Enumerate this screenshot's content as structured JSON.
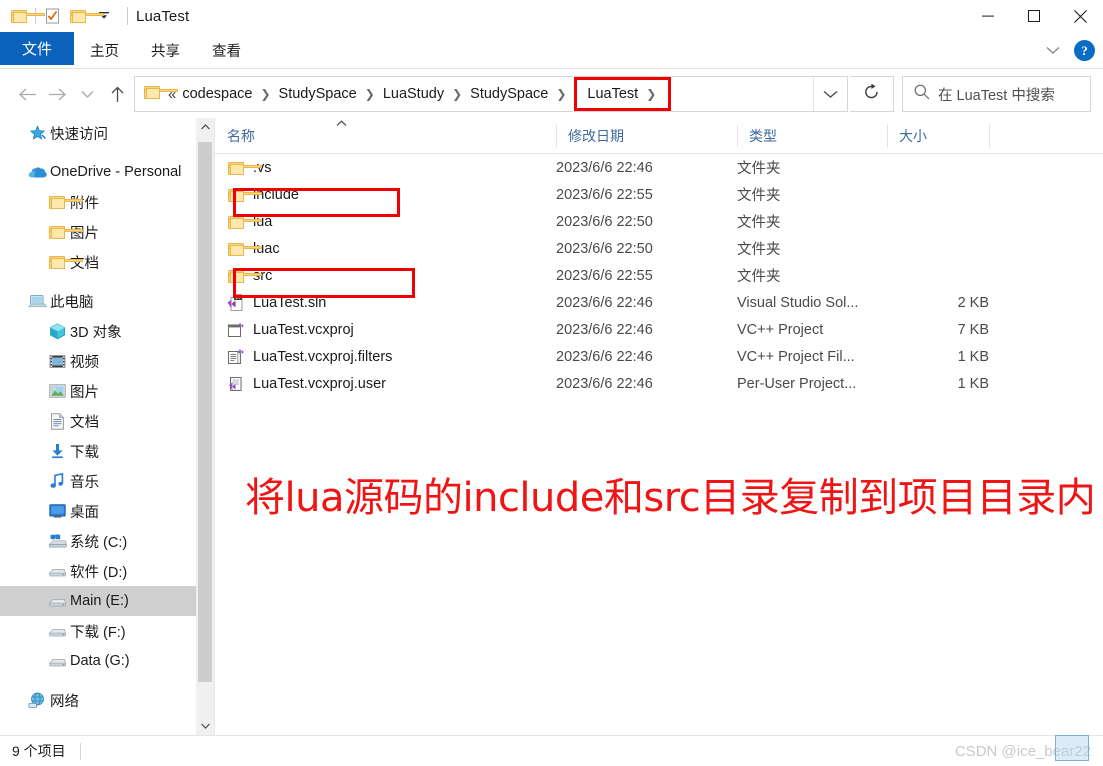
{
  "window": {
    "title": "LuaTest",
    "quick_access_icons": [
      "folder-icon",
      "properties-icon",
      "new-folder-icon",
      "customize-dropdown-icon"
    ],
    "minimize_label": "最小化",
    "maximize_label": "最大化",
    "close_label": "关闭"
  },
  "ribbon": {
    "tabs": [
      {
        "label": "文件",
        "active": true
      },
      {
        "label": "主页",
        "active": false
      },
      {
        "label": "共享",
        "active": false
      },
      {
        "label": "查看",
        "active": false
      }
    ],
    "collapse_icon": "chevron-down-icon",
    "help_label": "?"
  },
  "navbar": {
    "back_label": "←",
    "forward_label": "→",
    "recent_label": "⌄",
    "up_label": "↑",
    "breadcrumb_prefix": "«",
    "breadcrumbs": [
      "codespace",
      "StudySpace",
      "LuaStudy",
      "StudySpace",
      "LuaTest"
    ],
    "breadcrumb_highlighted": "LuaTest",
    "dropdown_icon": "chevron-down-icon",
    "refresh_icon": "refresh-icon",
    "search_icon": "search-icon",
    "search_placeholder": "在 LuaTest 中搜索"
  },
  "sidebar": {
    "items": [
      {
        "label": "快速访问",
        "icon": "star-pin-icon",
        "level": 0,
        "selected": false,
        "gap_before": false
      },
      {
        "label": "OneDrive - Personal",
        "icon": "onedrive-cloud-icon",
        "level": 0,
        "selected": false,
        "gap_before": true
      },
      {
        "label": "附件",
        "icon": "folder-icon",
        "level": 1,
        "selected": false,
        "gap_before": false
      },
      {
        "label": "图片",
        "icon": "folder-icon",
        "level": 1,
        "selected": false,
        "gap_before": false
      },
      {
        "label": "文档",
        "icon": "folder-icon",
        "level": 1,
        "selected": false,
        "gap_before": false
      },
      {
        "label": "此电脑",
        "icon": "this-pc-icon",
        "level": 0,
        "selected": false,
        "gap_before": true
      },
      {
        "label": "3D 对象",
        "icon": "3d-objects-icon",
        "level": 1,
        "selected": false,
        "gap_before": false
      },
      {
        "label": "视频",
        "icon": "videos-icon",
        "level": 1,
        "selected": false,
        "gap_before": false
      },
      {
        "label": "图片",
        "icon": "pictures-icon",
        "level": 1,
        "selected": false,
        "gap_before": false
      },
      {
        "label": "文档",
        "icon": "documents-icon",
        "level": 1,
        "selected": false,
        "gap_before": false
      },
      {
        "label": "下载",
        "icon": "downloads-icon",
        "level": 1,
        "selected": false,
        "gap_before": false
      },
      {
        "label": "音乐",
        "icon": "music-icon",
        "level": 1,
        "selected": false,
        "gap_before": false
      },
      {
        "label": "桌面",
        "icon": "desktop-icon",
        "level": 1,
        "selected": false,
        "gap_before": false
      },
      {
        "label": "系统 (C:)",
        "icon": "windows-drive-icon",
        "level": 1,
        "selected": false,
        "gap_before": false
      },
      {
        "label": "软件 (D:)",
        "icon": "drive-icon",
        "level": 1,
        "selected": false,
        "gap_before": false
      },
      {
        "label": "Main (E:)",
        "icon": "drive-icon",
        "level": 1,
        "selected": true,
        "gap_before": false
      },
      {
        "label": "下载 (F:)",
        "icon": "drive-icon",
        "level": 1,
        "selected": false,
        "gap_before": false
      },
      {
        "label": "Data (G:)",
        "icon": "drive-icon",
        "level": 1,
        "selected": false,
        "gap_before": false
      },
      {
        "label": "网络",
        "icon": "network-icon",
        "level": 0,
        "selected": false,
        "gap_before": true
      }
    ],
    "scroll_up_icon": "chevron-up-icon",
    "scroll_down_icon": "chevron-down-icon"
  },
  "filelist": {
    "columns": [
      {
        "label": "名称",
        "sorted": true,
        "sort_direction": "asc"
      },
      {
        "label": "修改日期",
        "sorted": false
      },
      {
        "label": "类型",
        "sorted": false
      },
      {
        "label": "大小",
        "sorted": false
      }
    ],
    "rows": [
      {
        "name": ".vs",
        "icon": "folder-icon",
        "date": "2023/6/6 22:46",
        "type": "文件夹",
        "size": "",
        "highlighted": false
      },
      {
        "name": "include",
        "icon": "folder-icon",
        "date": "2023/6/6 22:55",
        "type": "文件夹",
        "size": "",
        "highlighted": true
      },
      {
        "name": "lua",
        "icon": "folder-icon",
        "date": "2023/6/6 22:50",
        "type": "文件夹",
        "size": "",
        "highlighted": false
      },
      {
        "name": "luac",
        "icon": "folder-icon",
        "date": "2023/6/6 22:50",
        "type": "文件夹",
        "size": "",
        "highlighted": false
      },
      {
        "name": "src",
        "icon": "folder-icon",
        "date": "2023/6/6 22:55",
        "type": "文件夹",
        "size": "",
        "highlighted": true
      },
      {
        "name": "LuaTest.sln",
        "icon": "vs-solution-icon",
        "date": "2023/6/6 22:46",
        "type": "Visual Studio Sol...",
        "size": "2 KB",
        "highlighted": false
      },
      {
        "name": "LuaTest.vcxproj",
        "icon": "vcxproj-icon",
        "date": "2023/6/6 22:46",
        "type": "VC++ Project",
        "size": "7 KB",
        "highlighted": false
      },
      {
        "name": "LuaTest.vcxproj.filters",
        "icon": "filters-icon",
        "date": "2023/6/6 22:46",
        "type": "VC++ Project Fil...",
        "size": "1 KB",
        "highlighted": false
      },
      {
        "name": "LuaTest.vcxproj.user",
        "icon": "user-project-icon",
        "date": "2023/6/6 22:46",
        "type": "Per-User Project...",
        "size": "1 KB",
        "highlighted": false
      }
    ]
  },
  "annotation": {
    "text": "将lua源码的include和src目录复制到项目目录内",
    "color": "#f01414"
  },
  "statusbar": {
    "item_count": "9 个项目"
  },
  "watermark": {
    "text": "CSDN @ice_bear22"
  },
  "colors": {
    "accent": "#0b62ba",
    "highlight_red": "#f00000",
    "column_header": "#3e6a9e",
    "selected_row": "#cfcfcf"
  }
}
